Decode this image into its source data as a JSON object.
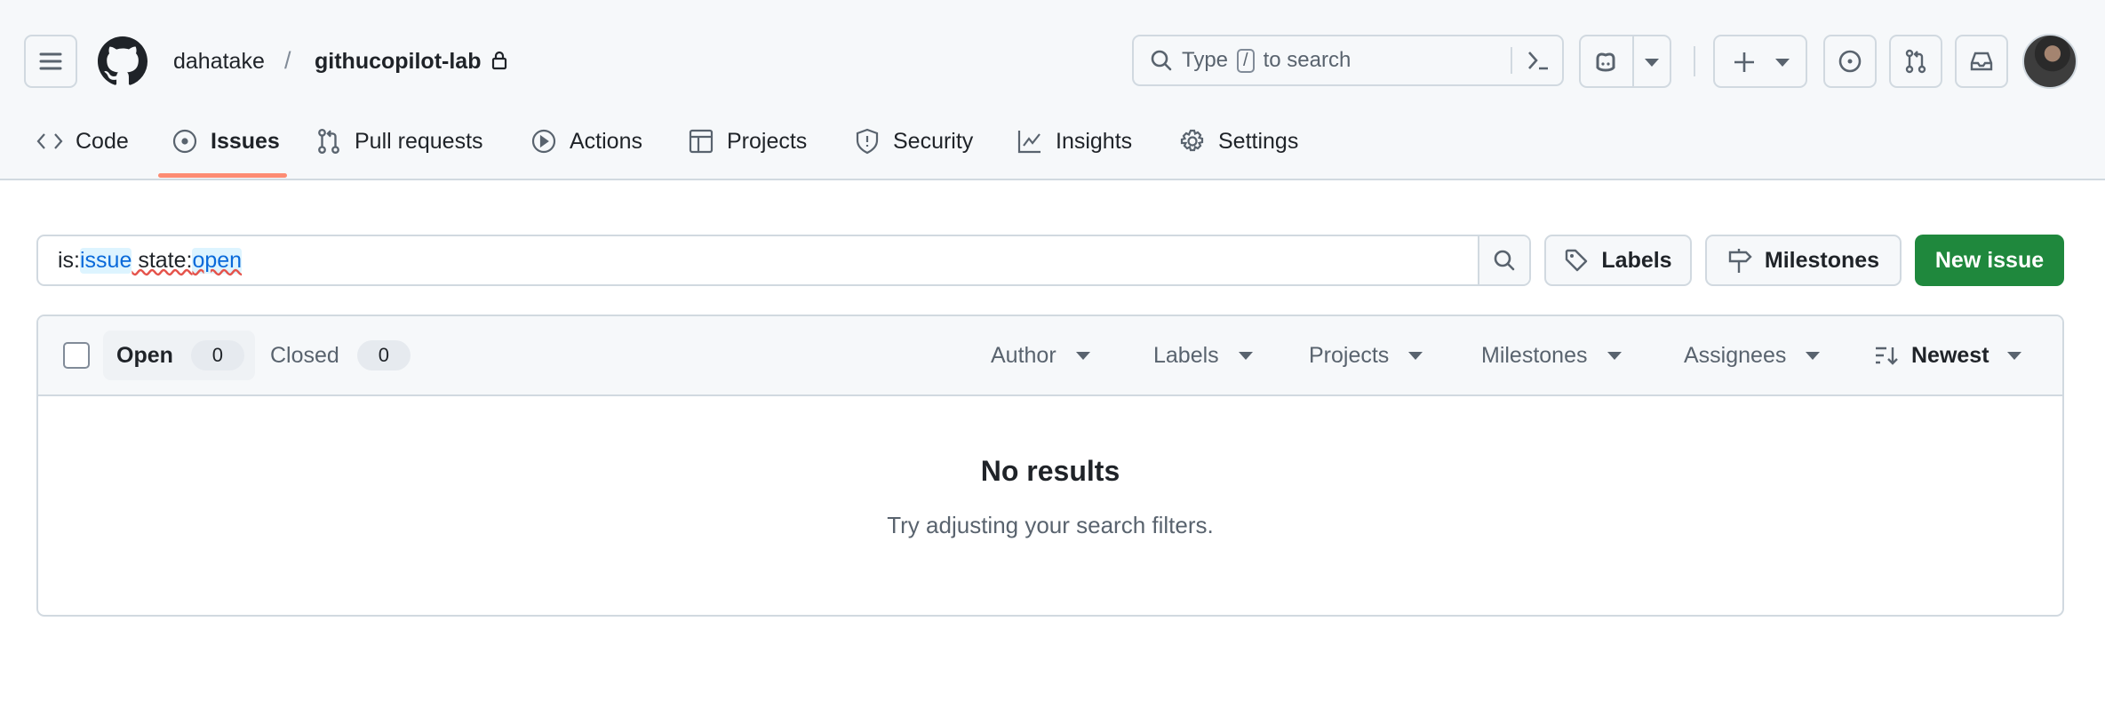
{
  "header": {
    "owner": "dahatake",
    "separator": "/",
    "repo": "githucopilot-lab",
    "search": {
      "prefix": "Type",
      "key": "/",
      "suffix": "to search"
    }
  },
  "nav": {
    "items": [
      {
        "label": "Code",
        "icon": "code-icon"
      },
      {
        "label": "Issues",
        "icon": "issue-opened-icon",
        "active": true
      },
      {
        "label": "Pull requests",
        "icon": "git-pull-request-icon"
      },
      {
        "label": "Actions",
        "icon": "play-icon"
      },
      {
        "label": "Projects",
        "icon": "table-icon"
      },
      {
        "label": "Security",
        "icon": "shield-icon"
      },
      {
        "label": "Insights",
        "icon": "graph-icon"
      },
      {
        "label": "Settings",
        "icon": "gear-icon"
      }
    ]
  },
  "toolbar": {
    "query": {
      "p1": "is:",
      "v1": "issue",
      "p2": " state:",
      "v2": "open"
    },
    "labels_label": "Labels",
    "milestones_label": "Milestones",
    "new_issue_label": "New issue"
  },
  "list": {
    "open_label": "Open",
    "open_count": "0",
    "closed_label": "Closed",
    "closed_count": "0",
    "filters": [
      "Author",
      "Labels",
      "Projects",
      "Milestones",
      "Assignees"
    ],
    "sort_label": "Newest",
    "empty_title": "No results",
    "empty_subtitle": "Try adjusting your search filters."
  },
  "colors": {
    "accent_underline": "#fd8c73",
    "primary_button": "#1f883d",
    "link": "#0969da"
  }
}
